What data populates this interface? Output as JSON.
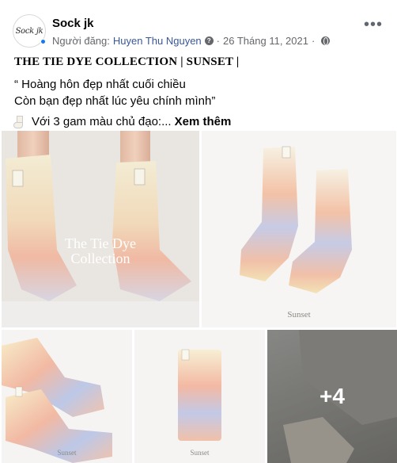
{
  "post": {
    "page_name": "Sock jk",
    "avatar_text": "Sock jk",
    "posted_by_label": "Người đăng:",
    "author": "Huyen Thu Nguyen",
    "separator": "·",
    "date": "26 Tháng 11, 2021",
    "title": "THE TIE DYE COLLECTION | SUNSET |",
    "line1": "“ Hoàng hôn đẹp nhất cuối chiều",
    "line2": "Còn bạn đẹp nhất lúc yêu chính mình”",
    "line3": "Với 3 gam màu chủ đạo:...",
    "see_more": "Xem thêm"
  },
  "photos": {
    "photo1_caption_line1": "The Tie Dye",
    "photo1_caption_line2": "Collection",
    "photo2_caption": "Sunset",
    "photo3_caption": "Sunset",
    "photo4_caption": "Sunset",
    "more_count": "+4"
  },
  "icons": {
    "info": "info-icon",
    "globe": "globe-icon",
    "more": "more-options-icon",
    "sock": "sock-emoji-icon"
  },
  "colors": {
    "link": "#385898",
    "meta": "#65676b",
    "badge": "#1877f2"
  }
}
